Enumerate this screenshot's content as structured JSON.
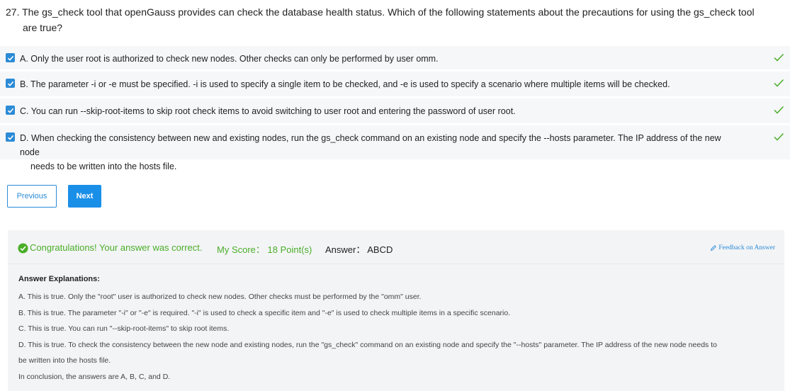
{
  "question": {
    "line1": "27. The gs_check tool that openGauss provides can check the database health status. Which of the following statements about the precautions for using the gs_check tool",
    "line2": "are true?"
  },
  "options": [
    {
      "line1": "A. Only the user root is authorized to check new nodes. Other checks can only be performed by user omm.",
      "line2": "",
      "checked": true,
      "correct": true
    },
    {
      "line1": "B. The parameter -i or -e must be specified. -i is used to specify a single item to be checked, and -e is used to specify a scenario where multiple items will be checked.",
      "line2": "",
      "checked": true,
      "correct": true
    },
    {
      "line1": "C. You can run --skip-root-items to skip root check items to avoid switching to user root and entering the password of user root.",
      "line2": "",
      "checked": true,
      "correct": true
    },
    {
      "line1": "D. When checking the consistency between new and existing nodes, run the gs_check command on an existing node and specify the --hosts parameter. The IP address of the new node",
      "line2": "needs to be written into the hosts file.",
      "checked": true,
      "correct": true
    }
  ],
  "buttons": {
    "previous": "Previous",
    "next": "Next"
  },
  "result": {
    "congrats": "Congratulations! Your answer was correct.",
    "score": "My Score： 18 Point(s)",
    "answer": "Answer： ABCD",
    "feedback": "Feedback on Answer"
  },
  "explanation": {
    "heading": "Answer Explanations:",
    "lines": [
      "A. This is true. Only the \"root\" user is authorized to check new nodes. Other checks must be performed by the \"omm\" user.",
      "B. This is true. The parameter \"-i\" or \"-e\" is required. \"-i\" is used to check a specific item and \"-e\" is used to check multiple items in a specific scenario.",
      "C. This is true. You can run \"--skip-root-items\" to skip root items.",
      "D. This is true. To check the consistency between the new node and existing nodes, run the \"gs_check\" command on an existing node and specify the \"--hosts\" parameter. The IP address of the new node needs to",
      "be written into the hosts file.",
      "In conclusion, the answers are A, B, C, and D."
    ]
  },
  "colors": {
    "accent": "#2b8bd6",
    "success": "#4aae28",
    "panel": "#f3f4f6",
    "option_bg": "#f6f7f9"
  },
  "icons": {
    "checkbox": "checkbox-checked-icon",
    "tick": "check-mark-icon",
    "ok": "success-circle-icon",
    "feedback": "edit-icon"
  }
}
